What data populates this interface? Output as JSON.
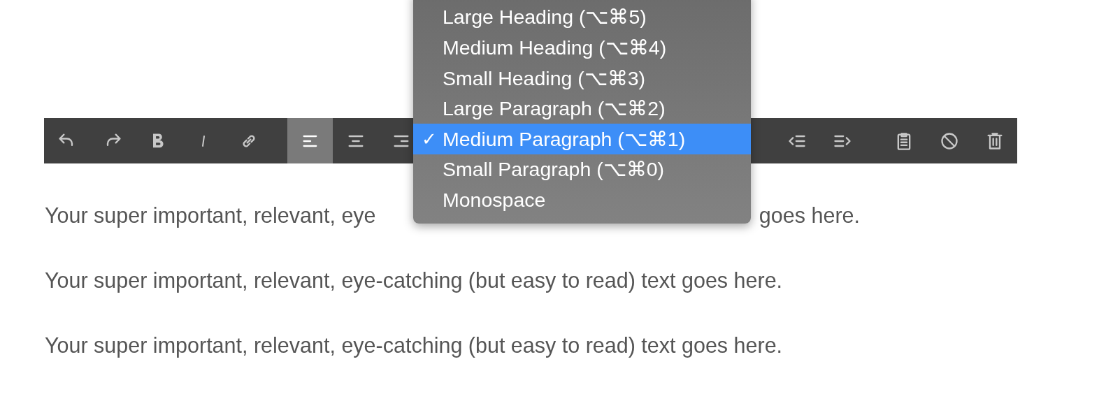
{
  "toolbar": {
    "left": [
      {
        "kind": "undo",
        "selected": false
      },
      {
        "kind": "redo",
        "selected": false
      },
      {
        "kind": "bold",
        "selected": false
      },
      {
        "kind": "italic",
        "selected": false
      },
      {
        "kind": "link",
        "selected": false
      },
      {
        "kind": "gap"
      },
      {
        "kind": "align-left",
        "selected": true
      },
      {
        "kind": "align-center",
        "selected": false
      },
      {
        "kind": "align-right",
        "selected": false
      }
    ],
    "right": [
      {
        "kind": "outdent",
        "selected": false
      },
      {
        "kind": "indent",
        "selected": false
      },
      {
        "kind": "gap"
      },
      {
        "kind": "clipboard",
        "selected": false
      },
      {
        "kind": "block",
        "selected": false
      },
      {
        "kind": "trash",
        "selected": false
      }
    ]
  },
  "format_menu": {
    "items": [
      {
        "label": "Large Heading (⌥⌘5)",
        "selected": false
      },
      {
        "label": "Medium Heading (⌥⌘4)",
        "selected": false
      },
      {
        "label": "Small Heading (⌥⌘3)",
        "selected": false
      },
      {
        "label": "Large Paragraph (⌥⌘2)",
        "selected": false
      },
      {
        "label": "Medium Paragraph (⌥⌘1)",
        "selected": true,
        "check": "✓"
      },
      {
        "label": "Small Paragraph (⌥⌘0)",
        "selected": false
      },
      {
        "label": "Monospace",
        "selected": false
      }
    ]
  },
  "paragraphs": [
    {
      "parts": [
        "Your super important, relevant, eye",
        "goes here."
      ]
    },
    {
      "parts": [
        "Your super important, relevant, eye-catching (but easy to read) text goes here."
      ]
    },
    {
      "parts": [
        "Your super important, relevant, eye-catching (but easy to read) text goes here."
      ]
    }
  ]
}
